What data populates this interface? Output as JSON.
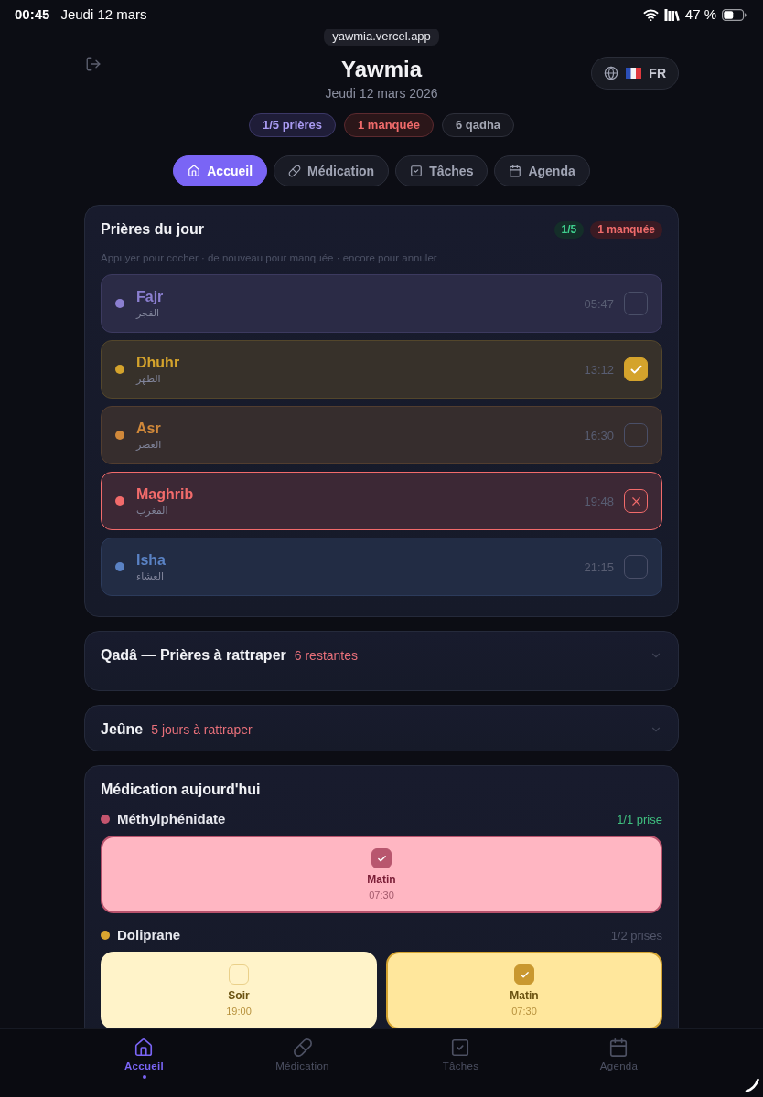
{
  "status_bar": {
    "time": "00:45",
    "date": "Jeudi 12 mars",
    "battery": "47 %"
  },
  "browser": {
    "address": "yawmia.vercel.app"
  },
  "header": {
    "title": "Yawmia",
    "date": "Jeudi 12 mars 2026",
    "language": "FR"
  },
  "summary": [
    {
      "kind": "prayers",
      "label": "1/5 prières"
    },
    {
      "kind": "missed",
      "label": "1 manquée"
    },
    {
      "kind": "qadha",
      "label": "6 qadha"
    }
  ],
  "tabs": [
    {
      "label": "Accueil",
      "selected": true
    },
    {
      "label": "Médication",
      "selected": false
    },
    {
      "label": "Tâches",
      "selected": false
    },
    {
      "label": "Agenda",
      "selected": false
    }
  ],
  "prayers": {
    "title": "Prières du jour",
    "badges": [
      {
        "kind": "done",
        "label": "1/5"
      },
      {
        "kind": "missed",
        "label": "1 manquée"
      }
    ],
    "hint": "Appuyer pour cocher · de nouveau pour manquée · encore pour annuler",
    "items": [
      {
        "name": "Fajr",
        "arabic": "الفجر",
        "time": "05:47",
        "color": "#8b7fd0",
        "checked": false,
        "missed": false
      },
      {
        "name": "Dhuhr",
        "arabic": "الظهر",
        "time": "13:12",
        "color": "#d4a32c",
        "checked": true,
        "missed": false
      },
      {
        "name": "Asr",
        "arabic": "العصر",
        "time": "16:30",
        "color": "#d0883a",
        "checked": false,
        "missed": false
      },
      {
        "name": "Maghrib",
        "arabic": "المغرب",
        "time": "19:48",
        "color": "#f26b6b",
        "checked": false,
        "missed": true
      },
      {
        "name": "Isha",
        "arabic": "العشاء",
        "time": "21:15",
        "color": "#5a82c4",
        "checked": false,
        "missed": false
      }
    ]
  },
  "sections": [
    {
      "title": "Qadâ — Prières à rattraper",
      "note": "6 restantes",
      "expanded": false
    },
    {
      "title": "Jeûne",
      "note": "5 jours à rattraper",
      "expanded": false
    }
  ],
  "medications": {
    "title": "Médication aujourd'hui",
    "items": [
      {
        "name": "Méthylphénidate",
        "color": "#c4556e",
        "progress": "1/1 prise",
        "complete": true,
        "doses": [
          {
            "label": "Matin",
            "time": "07:30",
            "checked": true
          }
        ]
      },
      {
        "name": "Doliprane",
        "color": "#d9a530",
        "progress": "1/2 prises",
        "complete": false,
        "doses": [
          {
            "label": "Soir",
            "time": "19:00",
            "checked": false
          },
          {
            "label": "Matin",
            "time": "07:30",
            "checked": true
          }
        ]
      }
    ]
  },
  "bottom_nav": [
    {
      "label": "Accueil",
      "selected": true
    },
    {
      "label": "Médication",
      "selected": false
    },
    {
      "label": "Tâches",
      "selected": false
    },
    {
      "label": "Agenda",
      "selected": false
    }
  ]
}
